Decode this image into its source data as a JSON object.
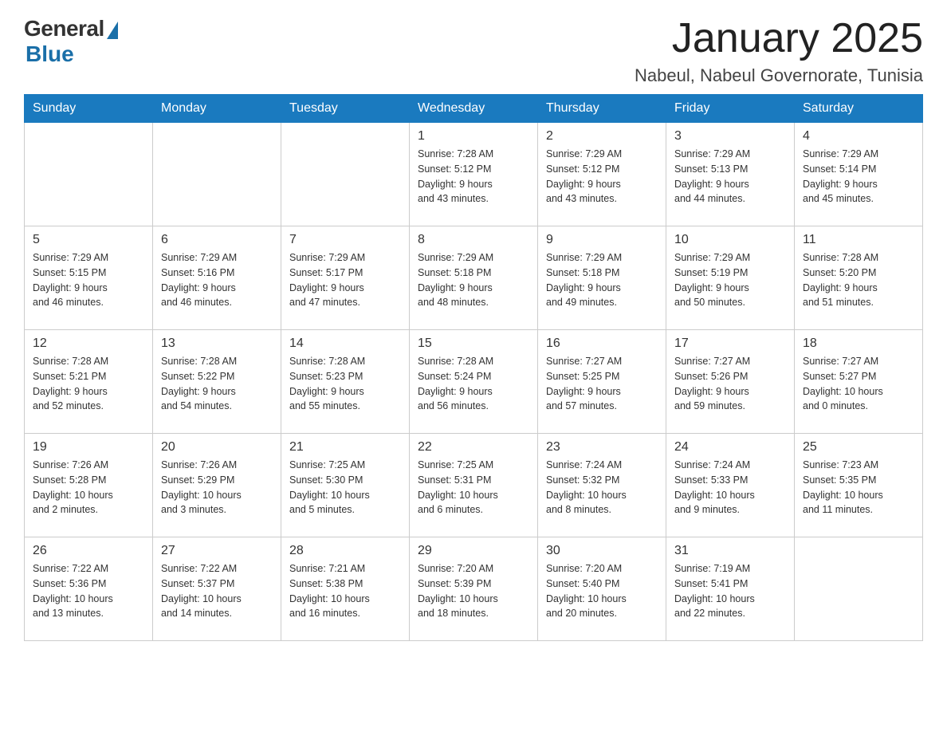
{
  "logo": {
    "general": "General",
    "blue": "Blue"
  },
  "header": {
    "month": "January 2025",
    "location": "Nabeul, Nabeul Governorate, Tunisia"
  },
  "days_of_week": [
    "Sunday",
    "Monday",
    "Tuesday",
    "Wednesday",
    "Thursday",
    "Friday",
    "Saturday"
  ],
  "weeks": [
    [
      {
        "day": "",
        "info": ""
      },
      {
        "day": "",
        "info": ""
      },
      {
        "day": "",
        "info": ""
      },
      {
        "day": "1",
        "info": "Sunrise: 7:28 AM\nSunset: 5:12 PM\nDaylight: 9 hours\nand 43 minutes."
      },
      {
        "day": "2",
        "info": "Sunrise: 7:29 AM\nSunset: 5:12 PM\nDaylight: 9 hours\nand 43 minutes."
      },
      {
        "day": "3",
        "info": "Sunrise: 7:29 AM\nSunset: 5:13 PM\nDaylight: 9 hours\nand 44 minutes."
      },
      {
        "day": "4",
        "info": "Sunrise: 7:29 AM\nSunset: 5:14 PM\nDaylight: 9 hours\nand 45 minutes."
      }
    ],
    [
      {
        "day": "5",
        "info": "Sunrise: 7:29 AM\nSunset: 5:15 PM\nDaylight: 9 hours\nand 46 minutes."
      },
      {
        "day": "6",
        "info": "Sunrise: 7:29 AM\nSunset: 5:16 PM\nDaylight: 9 hours\nand 46 minutes."
      },
      {
        "day": "7",
        "info": "Sunrise: 7:29 AM\nSunset: 5:17 PM\nDaylight: 9 hours\nand 47 minutes."
      },
      {
        "day": "8",
        "info": "Sunrise: 7:29 AM\nSunset: 5:18 PM\nDaylight: 9 hours\nand 48 minutes."
      },
      {
        "day": "9",
        "info": "Sunrise: 7:29 AM\nSunset: 5:18 PM\nDaylight: 9 hours\nand 49 minutes."
      },
      {
        "day": "10",
        "info": "Sunrise: 7:29 AM\nSunset: 5:19 PM\nDaylight: 9 hours\nand 50 minutes."
      },
      {
        "day": "11",
        "info": "Sunrise: 7:28 AM\nSunset: 5:20 PM\nDaylight: 9 hours\nand 51 minutes."
      }
    ],
    [
      {
        "day": "12",
        "info": "Sunrise: 7:28 AM\nSunset: 5:21 PM\nDaylight: 9 hours\nand 52 minutes."
      },
      {
        "day": "13",
        "info": "Sunrise: 7:28 AM\nSunset: 5:22 PM\nDaylight: 9 hours\nand 54 minutes."
      },
      {
        "day": "14",
        "info": "Sunrise: 7:28 AM\nSunset: 5:23 PM\nDaylight: 9 hours\nand 55 minutes."
      },
      {
        "day": "15",
        "info": "Sunrise: 7:28 AM\nSunset: 5:24 PM\nDaylight: 9 hours\nand 56 minutes."
      },
      {
        "day": "16",
        "info": "Sunrise: 7:27 AM\nSunset: 5:25 PM\nDaylight: 9 hours\nand 57 minutes."
      },
      {
        "day": "17",
        "info": "Sunrise: 7:27 AM\nSunset: 5:26 PM\nDaylight: 9 hours\nand 59 minutes."
      },
      {
        "day": "18",
        "info": "Sunrise: 7:27 AM\nSunset: 5:27 PM\nDaylight: 10 hours\nand 0 minutes."
      }
    ],
    [
      {
        "day": "19",
        "info": "Sunrise: 7:26 AM\nSunset: 5:28 PM\nDaylight: 10 hours\nand 2 minutes."
      },
      {
        "day": "20",
        "info": "Sunrise: 7:26 AM\nSunset: 5:29 PM\nDaylight: 10 hours\nand 3 minutes."
      },
      {
        "day": "21",
        "info": "Sunrise: 7:25 AM\nSunset: 5:30 PM\nDaylight: 10 hours\nand 5 minutes."
      },
      {
        "day": "22",
        "info": "Sunrise: 7:25 AM\nSunset: 5:31 PM\nDaylight: 10 hours\nand 6 minutes."
      },
      {
        "day": "23",
        "info": "Sunrise: 7:24 AM\nSunset: 5:32 PM\nDaylight: 10 hours\nand 8 minutes."
      },
      {
        "day": "24",
        "info": "Sunrise: 7:24 AM\nSunset: 5:33 PM\nDaylight: 10 hours\nand 9 minutes."
      },
      {
        "day": "25",
        "info": "Sunrise: 7:23 AM\nSunset: 5:35 PM\nDaylight: 10 hours\nand 11 minutes."
      }
    ],
    [
      {
        "day": "26",
        "info": "Sunrise: 7:22 AM\nSunset: 5:36 PM\nDaylight: 10 hours\nand 13 minutes."
      },
      {
        "day": "27",
        "info": "Sunrise: 7:22 AM\nSunset: 5:37 PM\nDaylight: 10 hours\nand 14 minutes."
      },
      {
        "day": "28",
        "info": "Sunrise: 7:21 AM\nSunset: 5:38 PM\nDaylight: 10 hours\nand 16 minutes."
      },
      {
        "day": "29",
        "info": "Sunrise: 7:20 AM\nSunset: 5:39 PM\nDaylight: 10 hours\nand 18 minutes."
      },
      {
        "day": "30",
        "info": "Sunrise: 7:20 AM\nSunset: 5:40 PM\nDaylight: 10 hours\nand 20 minutes."
      },
      {
        "day": "31",
        "info": "Sunrise: 7:19 AM\nSunset: 5:41 PM\nDaylight: 10 hours\nand 22 minutes."
      },
      {
        "day": "",
        "info": ""
      }
    ]
  ]
}
